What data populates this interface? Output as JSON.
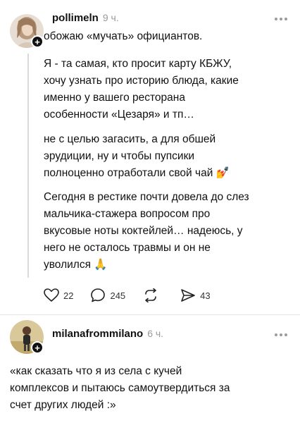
{
  "post1": {
    "username": "pollimeln",
    "time": "9 ч.",
    "title": "обожаю «мучать» официантов.",
    "paragraphs": [
      [
        "Я - та самая, кто просит карту КБЖУ,",
        "хочу узнать про историю блюда, какие",
        "именно у вашего ресторана",
        "особенности «Цезаря» и тп…"
      ],
      [
        "не с целью загасить, а для обшей",
        "эрудиции, ну и чтобы пупсики",
        "полноценно отработали свой чай 💅"
      ],
      [
        "Сегодня в рестике почти довела до слез",
        "мальчика-стажера вопросом про",
        "вкусовые ноты коктейлей… надеюсь, у",
        "него не осталось травмы и он не",
        "уволился 🙏"
      ]
    ],
    "actions": {
      "likes": "22",
      "comments": "245",
      "reposts": "",
      "shares": "43"
    }
  },
  "post2": {
    "username": "milanafrommilano",
    "time": "6 ч.",
    "lines": [
      "«как сказать что я из села с кучей",
      "комплексов и пытаюсь самоутвердиться за",
      "счет других людей :»"
    ]
  },
  "colors": {
    "text": "#111111",
    "muted": "#9a9a9a",
    "line": "#d9d9d9"
  }
}
